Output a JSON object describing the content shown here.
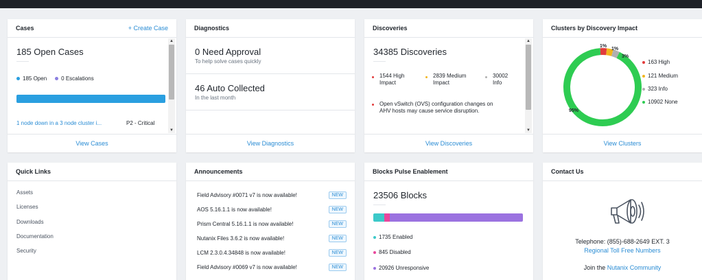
{
  "cases": {
    "title": "Cases",
    "action": "+ Create Case",
    "open_cases": "185 Open Cases",
    "open_label": "185 Open",
    "escalations_label": "0 Escalations",
    "case_link": "1 node down in a 3 node cluster i...",
    "case_priority": "P2 - Critical",
    "footer": "View Cases",
    "colors": {
      "open": "#2a9fe0",
      "escalations": "#8b7fe0",
      "bar": "#2a9fe0"
    }
  },
  "diagnostics": {
    "title": "Diagnostics",
    "need_approval": "0 Need Approval",
    "need_approval_sub": "To help solve cases quickly",
    "auto_collected": "46 Auto Collected",
    "auto_collected_sub": "In the last month",
    "footer": "View Diagnostics"
  },
  "discoveries": {
    "title": "Discoveries",
    "count": "34385 Discoveries",
    "high_line1": "1544 High",
    "high_line2": "Impact",
    "medium_line1": "2839 Medium",
    "medium_line2": "Impact",
    "info_line1": "30002",
    "info_line2": "Info",
    "item_line1": "Open vSwitch (OVS) configuration changes on",
    "item_line2": "AHV hosts may cause service disruption.",
    "footer": "View Discoveries",
    "colors": {
      "high": "#e23b3b",
      "medium": "#f2b51d",
      "info": "#b0b0b0"
    }
  },
  "clusters": {
    "title": "Clusters by Discovery Impact",
    "footer": "View Clusters",
    "labels": {
      "high_pct": "1%",
      "medium_pct": "1%",
      "info_pct": "3%",
      "none_pct": "95%"
    },
    "legend": [
      {
        "label": "163 High",
        "color": "#e23b3b"
      },
      {
        "label": "121 Medium",
        "color": "#f2b51d"
      },
      {
        "label": "323 Info",
        "color": "#b0b0b0"
      },
      {
        "label": "10902 None",
        "color": "#2ecc52"
      }
    ],
    "chart_data": {
      "type": "pie",
      "categories": [
        "High",
        "Medium",
        "Info",
        "None"
      ],
      "values": [
        163,
        121,
        323,
        10902
      ],
      "colors": [
        "#e23b3b",
        "#f2b51d",
        "#b0b0b0",
        "#2ecc52"
      ]
    }
  },
  "quick_links": {
    "title": "Quick Links",
    "items": [
      "Assets",
      "Licenses",
      "Downloads",
      "Documentation",
      "Security"
    ]
  },
  "announcements": {
    "title": "Announcements",
    "badge": "NEW",
    "items": [
      "Field Advisory #0071 v7 is now available!",
      "AOS 5.16.1.1 is now available!",
      "Prism Central 5.16.1.1 is now available!",
      "Nutanix Files 3.6.2 is now available!",
      "LCM 2.3.0.4.34848 is now available!",
      "Field Advisory #0069 v7 is now available!"
    ]
  },
  "blocks": {
    "title": "Blocks Pulse Enablement",
    "count": "23506 Blocks",
    "enabled": "1735 Enabled",
    "disabled": "845 Disabled",
    "unresponsive": "20926 Unresponsive",
    "chart_data": {
      "type": "bar",
      "categories": [
        "Enabled",
        "Disabled",
        "Unresponsive"
      ],
      "values": [
        1735,
        845,
        20926
      ],
      "colors": [
        "#3cc9c9",
        "#e8479c",
        "#9b72e0"
      ]
    }
  },
  "contact": {
    "title": "Contact Us",
    "telephone": "Telephone: (855)-688-2649 EXT. 3",
    "toll_free": "Regional Toll Free Numbers",
    "join_prefix": "Join the",
    "community": "Nutanix Community"
  }
}
